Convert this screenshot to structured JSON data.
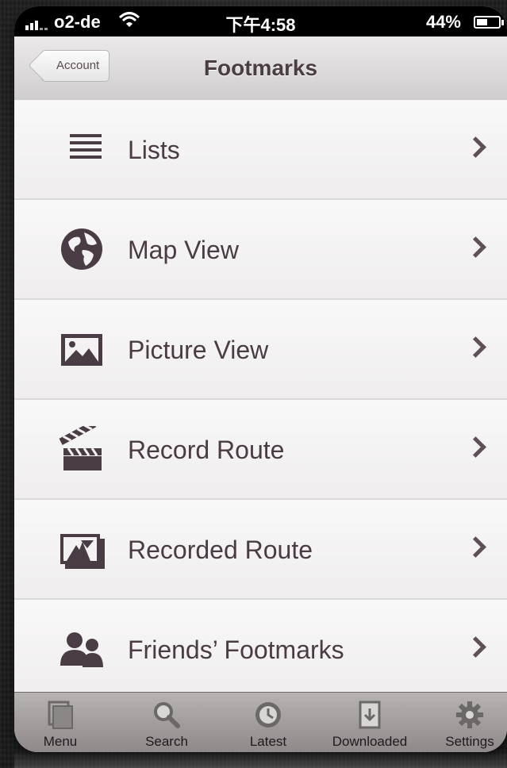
{
  "status_bar": {
    "carrier": "o2-de",
    "time": "下午4:58",
    "battery": "44%"
  },
  "nav": {
    "back_label": "Account",
    "title": "Footmarks"
  },
  "menu": [
    {
      "label": "Lists",
      "icon": "list-icon"
    },
    {
      "label": "Map View",
      "icon": "globe-icon"
    },
    {
      "label": "Picture View",
      "icon": "picture-icon"
    },
    {
      "label": "Record Route",
      "icon": "clapperboard-icon"
    },
    {
      "label": "Recorded Route",
      "icon": "photo-stack-icon"
    },
    {
      "label": "Friends’ Footmarks",
      "icon": "people-icon"
    }
  ],
  "tabbar": [
    {
      "label": "Menu",
      "icon": "menu-icon"
    },
    {
      "label": "Search",
      "icon": "search-icon"
    },
    {
      "label": "Latest",
      "icon": "clock-icon"
    },
    {
      "label": "Downloaded",
      "icon": "download-icon"
    },
    {
      "label": "Settings",
      "icon": "gear-icon"
    }
  ],
  "colors": {
    "accent": "#4a3c44",
    "row_bg": "#f5f3f3",
    "tabbar_bg": "#a39e9e"
  }
}
